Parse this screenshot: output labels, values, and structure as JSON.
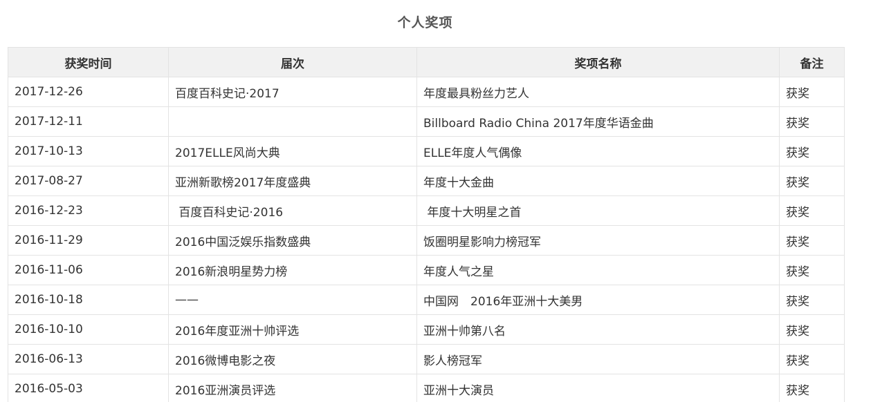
{
  "section_title": "个人奖项",
  "table": {
    "headers": {
      "date": "获奖时间",
      "session": "届次",
      "award": "奖项名称",
      "note": "备注"
    },
    "rows": [
      {
        "date": "2017-12-26",
        "session": "百度百科史记·2017",
        "award": "年度最具粉丝力艺人",
        "note": "获奖"
      },
      {
        "date": "2017-12-11",
        "session": "",
        "award": "Billboard Radio China 2017年度华语金曲",
        "note": "获奖"
      },
      {
        "date": "2017-10-13",
        "session": "2017ELLE风尚大典",
        "award": "ELLE年度人气偶像",
        "note": "获奖"
      },
      {
        "date": "2017-08-27",
        "session": "亚洲新歌榜2017年度盛典",
        "award": "年度十大金曲",
        "note": "获奖"
      },
      {
        "date": "2016-12-23",
        "session": " 百度百科史记·2016",
        "award": " 年度十大明星之首",
        "note": "获奖"
      },
      {
        "date": "2016-11-29",
        "session": "2016中国泛娱乐指数盛典",
        "award": "饭圈明星影响力榜冠军",
        "note": "获奖"
      },
      {
        "date": "2016-11-06",
        "session": "2016新浪明星势力榜",
        "award": "年度人气之星",
        "note": "获奖"
      },
      {
        "date": "2016-10-18",
        "session": "——",
        "award": "中国网　2016年亚洲十大美男",
        "note": "获奖"
      },
      {
        "date": "2016-10-10",
        "session": "2016年度亚洲十帅评选",
        "award": "亚洲十帅第八名",
        "note": "获奖"
      },
      {
        "date": "2016-06-13",
        "session": "2016微博电影之夜",
        "award": "影人榜冠军",
        "note": "获奖"
      },
      {
        "date": "2016-05-03",
        "session": "2016亚洲演员评选",
        "award": "亚洲十大演员",
        "note": "获奖"
      }
    ]
  }
}
